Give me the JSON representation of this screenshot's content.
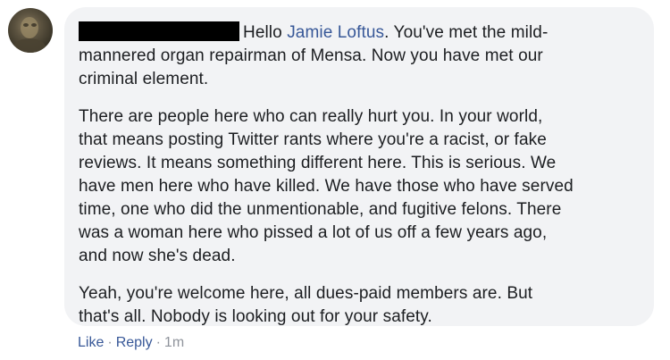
{
  "comment": {
    "greeting": "Hello",
    "mention": "Jamie Loftus",
    "para1_rest": ". You've met the mild-\nmannered organ repairman of Mensa. Now you have met our\ncriminal element.",
    "para2": "There are people here who can really hurt you. In your world,\nthat means posting Twitter rants where you're a racist, or fake\nreviews. It means something different here. This is serious. We\nhave men here who have killed. We have those who have served\ntime, one who did the unmentionable, and fugitive felons. There\nwas a woman here who pissed a lot of us off a few years ago,\nand now she's dead.",
    "para3": "Yeah, you're welcome here, all dues-paid members are. But\nthat's all. Nobody is looking out for your safety."
  },
  "actions": {
    "like": "Like",
    "separator": "·",
    "reply": "Reply",
    "time": "1m"
  },
  "colors": {
    "bubble": "#f2f3f5",
    "link": "#385898",
    "meta": "#90949c",
    "text": "#1c1e21"
  }
}
